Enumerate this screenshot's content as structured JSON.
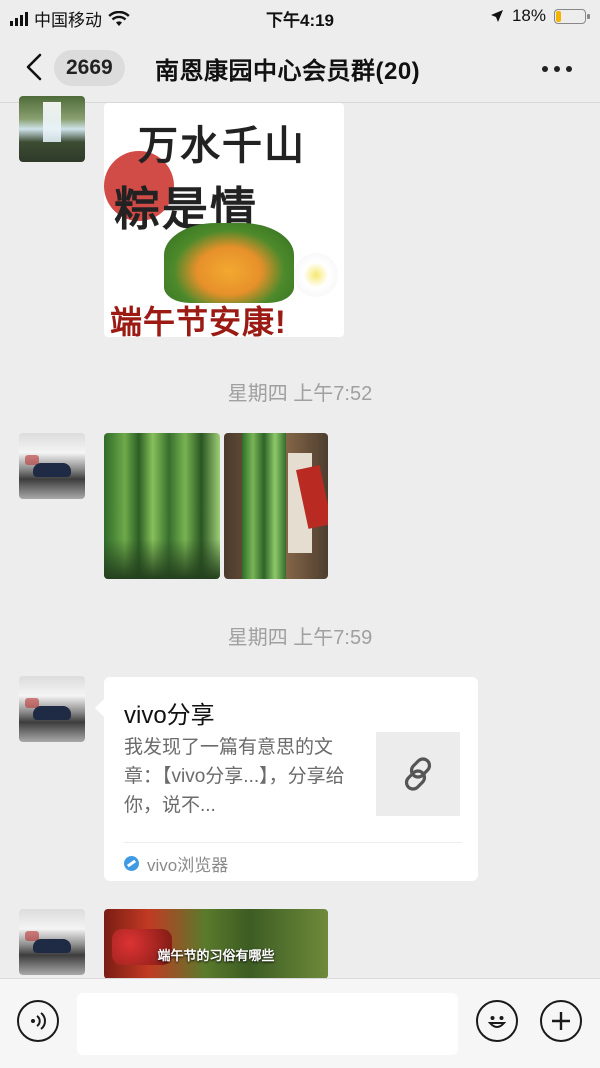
{
  "status_bar": {
    "carrier": "中国移动",
    "time": "下午4:19",
    "battery_percent": "18%",
    "battery_level": 0.18,
    "icons": [
      "signal-icon",
      "wifi-icon",
      "location-icon",
      "battery-icon"
    ]
  },
  "nav": {
    "back_icon": "chevron-left-icon",
    "unread_count": "2669",
    "title": "南恩康园中心会员群(20)",
    "more_icon": "more-dots-icon"
  },
  "messages": {
    "greeting_image": {
      "line1": "万水千山",
      "line2": "粽是情",
      "line3": "端午节安康!"
    },
    "timestamp_1": "星期四 上午7:52",
    "timestamp_2": "星期四 上午7:59",
    "link_card": {
      "title": "vivo分享",
      "description": "我发现了一篇有意思的文章：【vivo分享...】，分享给你，说不...",
      "thumb_icon": "link-icon",
      "source_icon": "vivo-browser-icon",
      "source": "vivo浏览器"
    },
    "video_caption": "端午节的习俗有哪些"
  },
  "input_bar": {
    "voice_icon": "voice-icon",
    "text_value": "",
    "emoji_icon": "emoji-icon",
    "plus_icon": "plus-icon"
  },
  "colors": {
    "background": "#ededed",
    "battery": "#f5b400",
    "timestamp_text": "#a0a0a0",
    "card_source_dot": "#3f9ae4"
  }
}
